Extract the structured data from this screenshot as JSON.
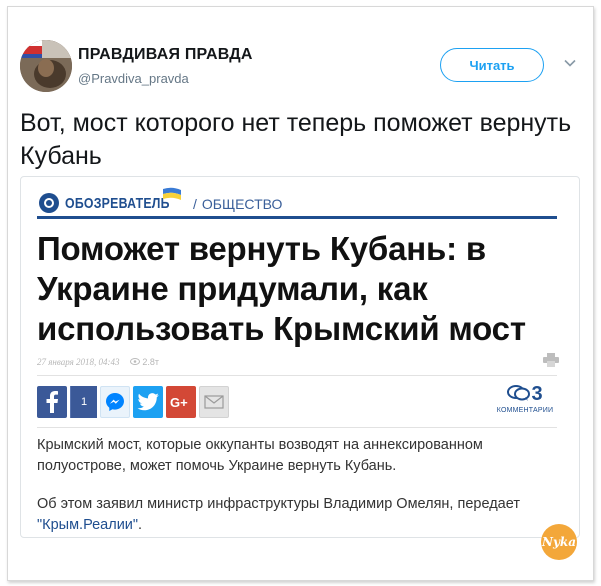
{
  "tweet": {
    "account_name": "ПРАВДИВАЯ ПРАВДА",
    "account_handle": "@Pravdiva_pravda",
    "follow_label": "Читать",
    "text": "Вот, мост которого нет теперь поможет вернуть Кубань"
  },
  "article": {
    "site_name": "ОБОЗРЕВАТЕЛЬ",
    "section_sep": "/",
    "section": "ОБЩЕСТВО",
    "headline": "Поможет вернуть Кубань: в Украине придумали, как использовать Крымский мост",
    "date": "27 января 2018, 04:43",
    "views": "2.8т",
    "facebook_count": "1",
    "comments_count": "3",
    "comments_label": "КОММЕНТАРИИ",
    "paragraph1": "Крымский мост, которые оккупанты возводят на аннексированном полуострове, может помочь Украине вернуть Кубань.",
    "paragraph2_prefix": "Об этом заявил министр инфраструктуры Владимир Омелян, передает ",
    "paragraph2_link": "\"Крым.Реалии\"",
    "paragraph2_suffix": "."
  },
  "watermark_text": "Nyka",
  "icons": [
    "chevron-down-icon",
    "facebook-icon",
    "messenger-icon",
    "twitter-icon",
    "google-plus-icon",
    "email-icon",
    "print-icon",
    "comments-icon",
    "eye-icon"
  ],
  "colors": {
    "accent": "#1da1f2",
    "brand": "#1f4e8f",
    "facebook": "#3b5998",
    "google_plus": "#d34836"
  }
}
